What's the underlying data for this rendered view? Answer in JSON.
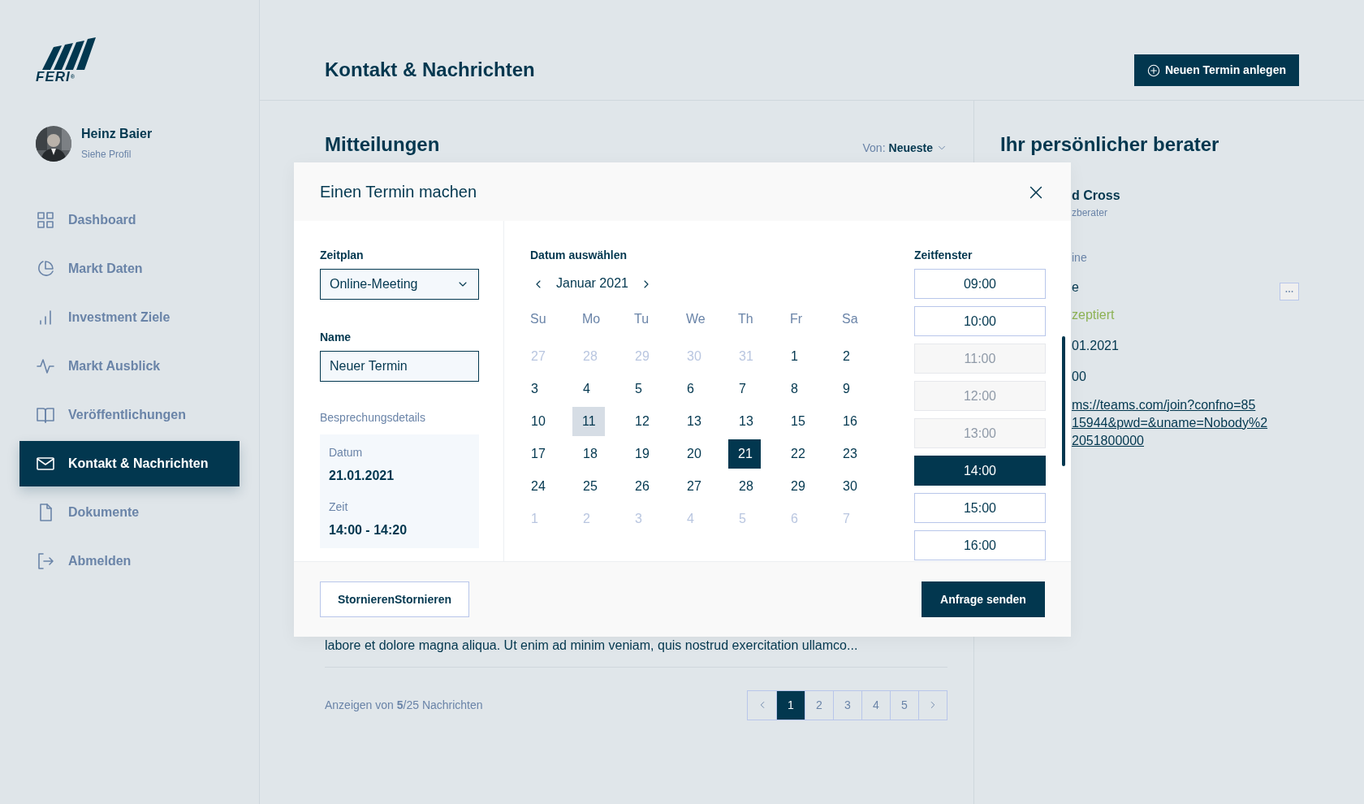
{
  "sidebar": {
    "logo": "FERI",
    "logo_mark": "®",
    "user": {
      "name": "Heinz Baier",
      "link": "Siehe Profil"
    },
    "items": [
      {
        "label": "Dashboard",
        "selected": false
      },
      {
        "label": "Markt Daten",
        "selected": false
      },
      {
        "label": "Investment Ziele",
        "selected": false
      },
      {
        "label": "Markt Ausblick",
        "selected": false
      },
      {
        "label": "Veröffentlichungen",
        "selected": false
      },
      {
        "label": "Kontakt & Nachrichten",
        "selected": true
      },
      {
        "label": "Dokumente",
        "selected": false
      },
      {
        "label": "Abmelden",
        "selected": false
      }
    ]
  },
  "header": {
    "title": "Kontakt & Nachrichten",
    "button": "Neuen Termin anlegen"
  },
  "messages": {
    "title": "Mitteilungen",
    "sort_label": "Von:",
    "sort_value": "Neueste",
    "preview": "labore et dolore magna aliqua. Ut enim ad minim veniam, quis nostrud exercitation ullamco...",
    "summary": "Anzeigen von **5**/25 Nachrichten",
    "pages": [
      {
        "label": "1",
        "selected": true
      },
      {
        "label": "2",
        "selected": false
      },
      {
        "label": "3",
        "selected": false
      },
      {
        "label": "4",
        "selected": false
      },
      {
        "label": "5",
        "selected": false
      }
    ]
  },
  "advisor": {
    "title": "Ihr persönlicher berater",
    "lines": [
      {
        "kind": "name",
        "text": "d Cross"
      },
      {
        "kind": "role",
        "text": "zberater"
      },
      {
        "kind": "label",
        "text": "ine"
      },
      {
        "kind": "value",
        "text": "e"
      },
      {
        "kind": "status",
        "text": "zeptiert"
      },
      {
        "kind": "value",
        "text": "01.2021"
      },
      {
        "kind": "value",
        "text": "00"
      },
      {
        "kind": "link",
        "text": "ms://teams.com/join?confno=85"
      },
      {
        "kind": "link",
        "text": "15944&pwd=&uname=Nobody%2"
      },
      {
        "kind": "link",
        "text": "2051800000"
      }
    ]
  },
  "modal": {
    "title": "Einen Termin machen",
    "schedule_label": "Zeitplan",
    "schedule_value": "Online-Meeting",
    "name_label": "Name",
    "name_value": "Neuer Termin",
    "details_title": "Besprechungsdetails",
    "date_label": "Datum",
    "date_value": "21.01.2021",
    "time_label": "Zeit",
    "time_value": "14:00 - 14:20",
    "calendar": {
      "label": "Datum auswählen",
      "month": "Januar 2021",
      "weekdays": [
        "Su",
        "Mo",
        "Tu",
        "We",
        "Th",
        "Fr",
        "Sa"
      ],
      "days": [
        {
          "label": "27",
          "muted": true,
          "today": false,
          "selected": false
        },
        {
          "label": "28",
          "muted": true,
          "today": false,
          "selected": false
        },
        {
          "label": "29",
          "muted": true,
          "today": false,
          "selected": false
        },
        {
          "label": "30",
          "muted": true,
          "today": false,
          "selected": false
        },
        {
          "label": "31",
          "muted": true,
          "today": false,
          "selected": false
        },
        {
          "label": "1",
          "muted": false,
          "today": false,
          "selected": false
        },
        {
          "label": "2",
          "muted": false,
          "today": false,
          "selected": false
        },
        {
          "label": "3",
          "muted": false,
          "today": false,
          "selected": false
        },
        {
          "label": "4",
          "muted": false,
          "today": false,
          "selected": false
        },
        {
          "label": "5",
          "muted": false,
          "today": false,
          "selected": false
        },
        {
          "label": "6",
          "muted": false,
          "today": false,
          "selected": false
        },
        {
          "label": "7",
          "muted": false,
          "today": false,
          "selected": false
        },
        {
          "label": "8",
          "muted": false,
          "today": false,
          "selected": false
        },
        {
          "label": "9",
          "muted": false,
          "today": false,
          "selected": false
        },
        {
          "label": "10",
          "muted": false,
          "today": false,
          "selected": false
        },
        {
          "label": "11",
          "muted": false,
          "today": true,
          "selected": false
        },
        {
          "label": "12",
          "muted": false,
          "today": false,
          "selected": false
        },
        {
          "label": "13",
          "muted": false,
          "today": false,
          "selected": false
        },
        {
          "label": "13",
          "muted": false,
          "today": false,
          "selected": false
        },
        {
          "label": "15",
          "muted": false,
          "today": false,
          "selected": false
        },
        {
          "label": "16",
          "muted": false,
          "today": false,
          "selected": false
        },
        {
          "label": "17",
          "muted": false,
          "today": false,
          "selected": false
        },
        {
          "label": "18",
          "muted": false,
          "today": false,
          "selected": false
        },
        {
          "label": "19",
          "muted": false,
          "today": false,
          "selected": false
        },
        {
          "label": "20",
          "muted": false,
          "today": false,
          "selected": false
        },
        {
          "label": "21",
          "muted": false,
          "today": false,
          "selected": true
        },
        {
          "label": "22",
          "muted": false,
          "today": false,
          "selected": false
        },
        {
          "label": "23",
          "muted": false,
          "today": false,
          "selected": false
        },
        {
          "label": "24",
          "muted": false,
          "today": false,
          "selected": false
        },
        {
          "label": "25",
          "muted": false,
          "today": false,
          "selected": false
        },
        {
          "label": "26",
          "muted": false,
          "today": false,
          "selected": false
        },
        {
          "label": "27",
          "muted": false,
          "today": false,
          "selected": false
        },
        {
          "label": "28",
          "muted": false,
          "today": false,
          "selected": false
        },
        {
          "label": "29",
          "muted": false,
          "today": false,
          "selected": false
        },
        {
          "label": "30",
          "muted": false,
          "today": false,
          "selected": false
        },
        {
          "label": "1",
          "muted": true,
          "today": false,
          "selected": false
        },
        {
          "label": "2",
          "muted": true,
          "today": false,
          "selected": false
        },
        {
          "label": "3",
          "muted": true,
          "today": false,
          "selected": false
        },
        {
          "label": "4",
          "muted": true,
          "today": false,
          "selected": false
        },
        {
          "label": "5",
          "muted": true,
          "today": false,
          "selected": false
        },
        {
          "label": "6",
          "muted": true,
          "today": false,
          "selected": false
        },
        {
          "label": "7",
          "muted": true,
          "today": false,
          "selected": false
        }
      ]
    },
    "slots_label": "Zeitfenster",
    "slots": [
      {
        "label": "09:00",
        "disabled": false,
        "selected": false
      },
      {
        "label": "10:00",
        "disabled": false,
        "selected": false
      },
      {
        "label": "11:00",
        "disabled": true,
        "selected": false
      },
      {
        "label": "12:00",
        "disabled": true,
        "selected": false
      },
      {
        "label": "13:00",
        "disabled": true,
        "selected": false
      },
      {
        "label": "14:00",
        "disabled": false,
        "selected": true
      },
      {
        "label": "15:00",
        "disabled": false,
        "selected": false
      },
      {
        "label": "16:00",
        "disabled": false,
        "selected": false
      }
    ],
    "cancel": "StornierenStornieren",
    "submit": "Anfrage senden"
  }
}
